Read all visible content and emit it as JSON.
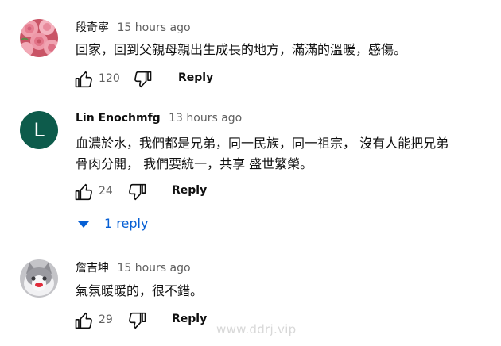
{
  "comments": [
    {
      "author": "段奇寧",
      "time": "15 hours ago",
      "text_lines": [
        "回家，回到父親母親出生成長的地方，滿滿的溫暖，感傷。"
      ],
      "likes": "120",
      "reply_label": "Reply",
      "avatar_icon": "pink-roses-avatar",
      "avatar_color": "#e07a86"
    },
    {
      "author": "Lin Enochmfg",
      "time": "13 hours ago",
      "text_lines": [
        "血濃於水，我們都是兄弟，同一民族，同一祖宗， 沒有人能把兄弟",
        "骨肉分開， 我們要統一，共享 盛世繁榮。"
      ],
      "likes": "24",
      "reply_label": "Reply",
      "avatar_letter": "L",
      "avatar_color": "#0d5b4b",
      "replies_label": "1 reply"
    },
    {
      "author": "詹吉坤",
      "time": "15 hours ago",
      "text_lines": [
        "氣氛暖暖的，很不錯。"
      ],
      "likes": "29",
      "reply_label": "Reply",
      "avatar_icon": "cat-avatar",
      "avatar_color": "#b9b9bd"
    }
  ],
  "watermark": "www.ddrj.vip",
  "colors": {
    "link_blue": "#065fd4",
    "meta_gray": "#606060",
    "text": "#0f0f0f"
  }
}
